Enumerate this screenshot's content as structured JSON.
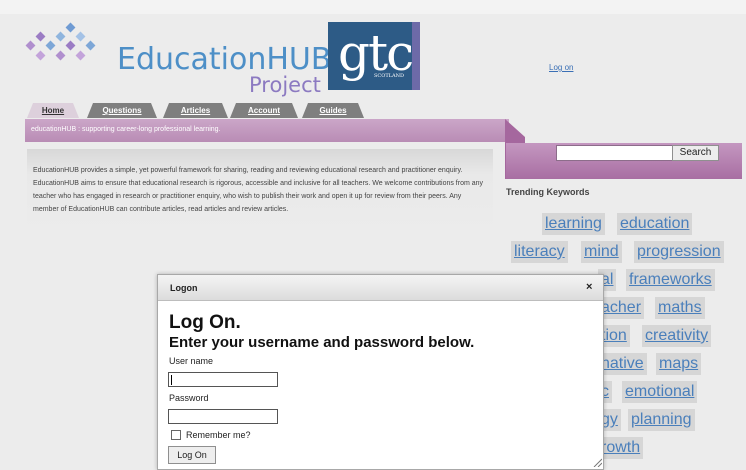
{
  "logo": {
    "word": "EducationHUB",
    "sub": "Project",
    "partner_letters": "gtc",
    "partner_sub": "SCOTLAND"
  },
  "header": {
    "logon_link": "Log on"
  },
  "tabs": [
    {
      "label": "Home"
    },
    {
      "label": "Questions"
    },
    {
      "label": "Articles"
    },
    {
      "label": "Account"
    },
    {
      "label": "Guides"
    }
  ],
  "banner": {
    "text": "educationHUB : supporting career-long professional learning."
  },
  "content": {
    "text": "EducationHUB provides a simple, yet powerful framework for sharing, reading and reviewing educational research and practitioner enquiry. EducationHUB aims to ensure that educational research is rigorous, accessible and inclusive for all teachers. We welcome contributions from any teacher who has engaged in research or practitioner enquiry, who wish to publish their work and open it up for review from their peers. Any member of EducationHUB can contribute articles, read articles and review articles."
  },
  "search": {
    "value": "",
    "button_label": "Search"
  },
  "trending": {
    "title": "Trending Keywords",
    "keywords": [
      "learning",
      "education",
      "literacy",
      "mind",
      "progression",
      "al",
      "frameworks",
      "acher",
      "maths",
      "tion",
      "creativity",
      "native",
      "maps",
      "c",
      "emotional",
      "gy",
      "planning",
      "rowth"
    ]
  },
  "modal": {
    "title": "Logon",
    "close": "×",
    "heading": "Log On.",
    "subheading": "Enter your username and password below.",
    "username_label": "User name",
    "username_value": "",
    "password_label": "Password",
    "password_value": "",
    "remember_label": "Remember me?",
    "submit_label": "Log On"
  },
  "colors": {
    "brand_blue": "#4d8fc7",
    "brand_purple": "#8c7ac1",
    "gtc_navy": "#2d5b86",
    "banner_pink": "#b98cb5",
    "keyword_link": "#4a7fbb"
  },
  "icons": [
    "logo-diamonds-icon",
    "close-icon",
    "resize-grip-icon"
  ]
}
